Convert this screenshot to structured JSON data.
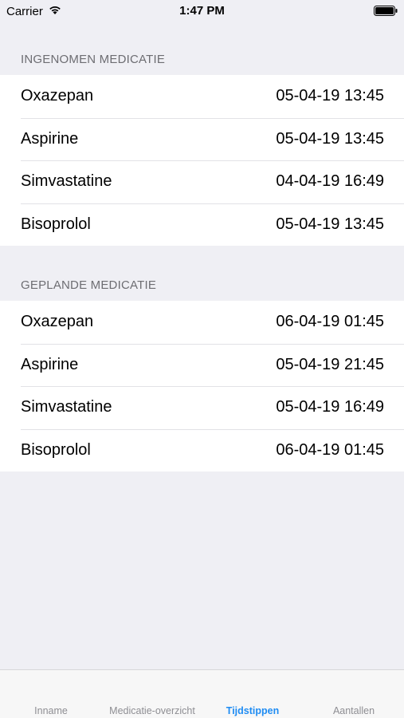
{
  "status_bar": {
    "carrier": "Carrier",
    "time": "1:47 PM"
  },
  "sections": [
    {
      "header": "INGENOMEN MEDICATIE",
      "rows": [
        {
          "name": "Oxazepan",
          "time": "05-04-19 13:45"
        },
        {
          "name": "Aspirine",
          "time": "05-04-19 13:45"
        },
        {
          "name": "Simvastatine",
          "time": "04-04-19 16:49"
        },
        {
          "name": "Bisoprolol",
          "time": "05-04-19 13:45"
        }
      ]
    },
    {
      "header": "GEPLANDE MEDICATIE",
      "rows": [
        {
          "name": "Oxazepan",
          "time": "06-04-19 01:45"
        },
        {
          "name": "Aspirine",
          "time": "05-04-19 21:45"
        },
        {
          "name": "Simvastatine",
          "time": "05-04-19 16:49"
        },
        {
          "name": "Bisoprolol",
          "time": "06-04-19 01:45"
        }
      ]
    }
  ],
  "tab_bar": {
    "tabs": [
      {
        "label": "Inname"
      },
      {
        "label": "Medicatie-overzicht"
      },
      {
        "label": "Tijdstippen"
      },
      {
        "label": "Aantallen"
      }
    ],
    "active_tab": "Tijdstippen",
    "accent_color": "#1f8cf3"
  }
}
